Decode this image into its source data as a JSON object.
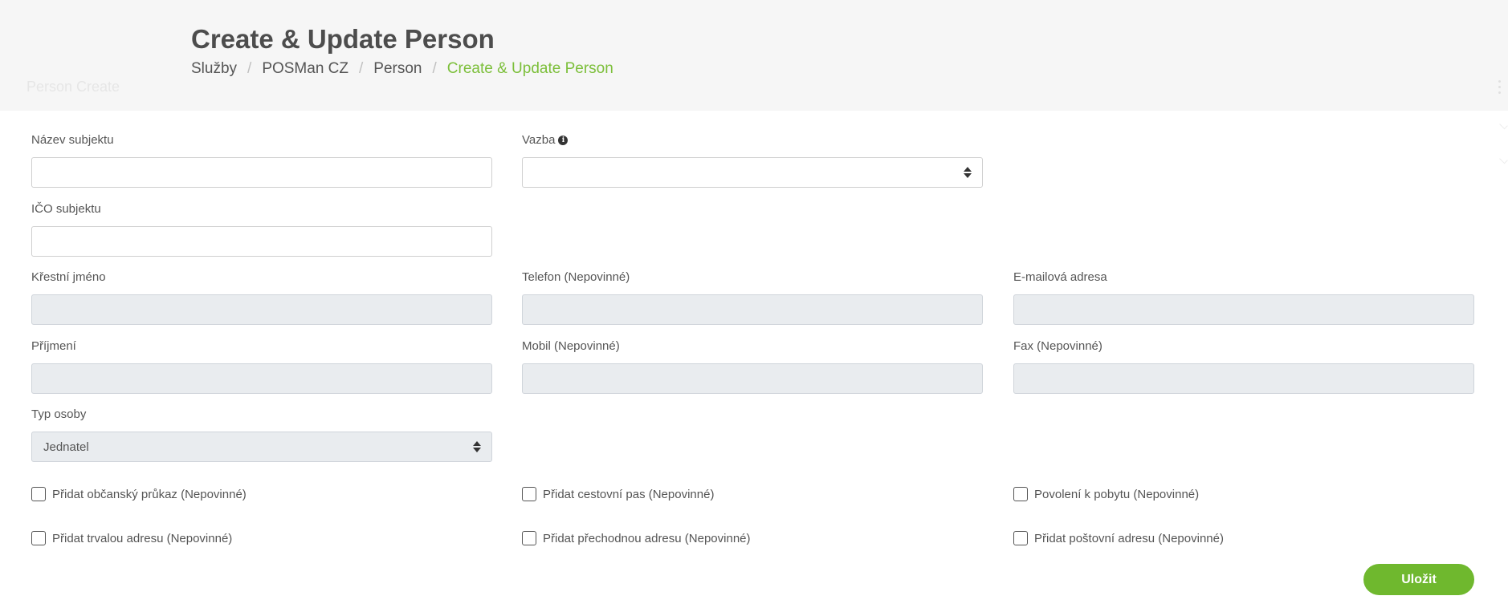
{
  "header": {
    "title": "Create & Update Person",
    "ghost_title": "Person Create",
    "breadcrumb": [
      {
        "label": "Služby"
      },
      {
        "label": "POSMan CZ"
      },
      {
        "label": "Person"
      },
      {
        "label": "Create & Update Person"
      }
    ],
    "separator": "/",
    "accent_color": "#7cbf3a"
  },
  "form": {
    "nazev_subjektu": {
      "label": "Název subjektu",
      "value": ""
    },
    "vazba": {
      "label": "Vazba",
      "value": "",
      "icon": "info-icon"
    },
    "ico_subjektu": {
      "label": "IČO subjektu",
      "value": ""
    },
    "krestni_jmeno": {
      "label": "Křestní jméno",
      "value": ""
    },
    "telefon": {
      "label": "Telefon (Nepovinné)",
      "value": ""
    },
    "email": {
      "label": "E-mailová adresa",
      "value": ""
    },
    "prijmeni": {
      "label": "Příjmení",
      "value": ""
    },
    "mobil": {
      "label": "Mobil (Nepovinné)",
      "value": ""
    },
    "fax": {
      "label": "Fax (Nepovinné)",
      "value": ""
    },
    "typ_osoby": {
      "label": "Typ osoby",
      "value": "Jednatel"
    }
  },
  "checkboxes": [
    {
      "label": "Přidat občanský průkaz (Nepovinné)",
      "checked": false
    },
    {
      "label": "Přidat cestovní pas (Nepovinné)",
      "checked": false
    },
    {
      "label": "Povolení k pobytu (Nepovinné)",
      "checked": false
    },
    {
      "label": "Přidat trvalou adresu (Nepovinné)",
      "checked": false
    },
    {
      "label": "Přidat přechodnou adresu (Nepovinné)",
      "checked": false
    },
    {
      "label": "Přidat poštovní adresu (Nepovinné)",
      "checked": false
    }
  ],
  "actions": {
    "save_label": "Uložit",
    "save_color": "#6fb82e"
  }
}
